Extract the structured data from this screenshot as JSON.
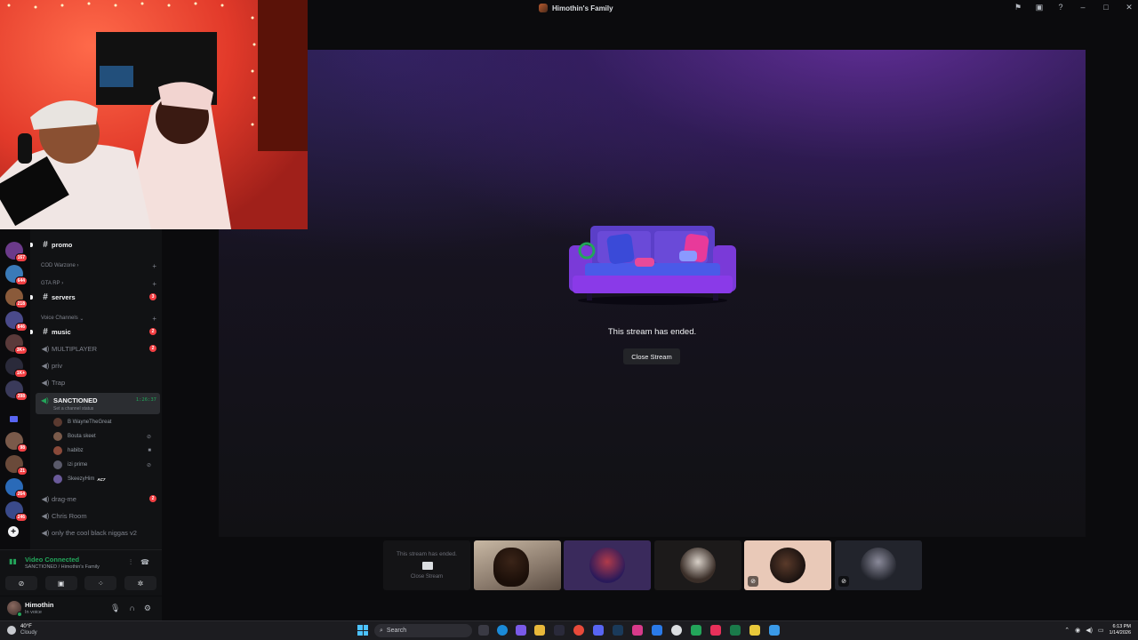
{
  "window": {
    "title": "Himothin's Family"
  },
  "rail": {
    "badges": [
      "167",
      "644",
      "218",
      "846",
      "3K+",
      "1K+",
      "398",
      "98",
      "21",
      "264",
      "246"
    ]
  },
  "channels": {
    "promo": "promo",
    "cat_warzone": "COD Warzone",
    "cat_gtarp": "GTA RP",
    "servers": "servers",
    "servers_badge": "3",
    "cat_voice": "Voice Channels",
    "music": "music",
    "music_badge": "2",
    "multiplayer": "MULTIPLAYER",
    "multiplayer_badge": "2",
    "priv": "priv",
    "trap": "Trap",
    "sanctioned": "SANCTIONED",
    "sanctioned_status": "Set a channel status",
    "sanctioned_timer": "1:26:37",
    "voice_users": [
      {
        "name": "B WayneTheGreat"
      },
      {
        "name": "Bouta skeet"
      },
      {
        "name": "habibz"
      },
      {
        "name": "izi prime"
      },
      {
        "name": "SkeezyHim",
        "tag": "AC7"
      }
    ],
    "drag_me": "drag-me",
    "drag_me_badge": "2",
    "chris_room": "Chris Room",
    "cool_v2": "only the cool black niggas v2"
  },
  "voice_panel": {
    "title": "Video Connected",
    "subtitle": "SANCTIONED / Himothin's Family"
  },
  "user": {
    "name": "Himothin",
    "status": "In voice"
  },
  "stream": {
    "ended_text": "This stream has ended.",
    "close_button": "Close Stream"
  },
  "thumbs": {
    "ended_label": "This stream has ended.",
    "close_label": "Close Stream"
  },
  "taskbar": {
    "temp": "40°F",
    "weather": "Cloudy",
    "search_placeholder": "Search",
    "time": "6:13 PM",
    "date": "1/14/2026"
  },
  "colors": {
    "accent_green": "#23a55a",
    "badge_red": "#f23f43",
    "brand": "#5865f2"
  }
}
